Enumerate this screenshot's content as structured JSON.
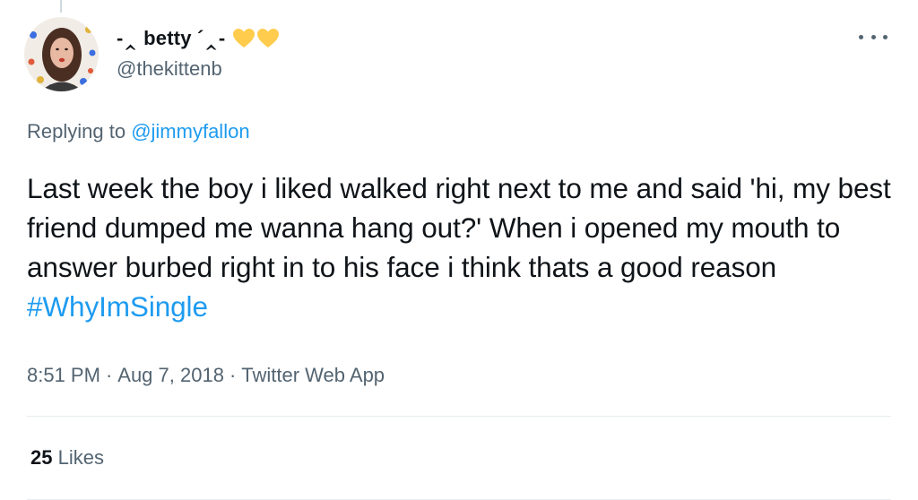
{
  "tweet": {
    "author": {
      "display_name": "-‸ betty ´‸-",
      "handle": "@thekittenb",
      "name_emojis": [
        "yellow-heart",
        "yellow-heart"
      ]
    },
    "more_icon": "more-horizontal-icon",
    "replying_prefix": "Replying to",
    "replying_to": "@jimmyfallon",
    "text": "Last week the boy i liked walked right next to me and said 'hi, my best friend dumped me wanna hang out?' When i opened my mouth to answer burbed right in to his face i think thats a good reason",
    "hashtag": "#WhyImSingle",
    "time": "8:51 PM",
    "separator": "·",
    "date": "Aug 7, 2018",
    "source": "Twitter Web App",
    "likes_count": "25",
    "likes_label": "Likes"
  },
  "colors": {
    "link": "#1d9bf0",
    "secondary_text": "#536471",
    "primary_text": "#0f1419",
    "heart": "#ffcc4d",
    "divider": "#e6ecf0"
  }
}
